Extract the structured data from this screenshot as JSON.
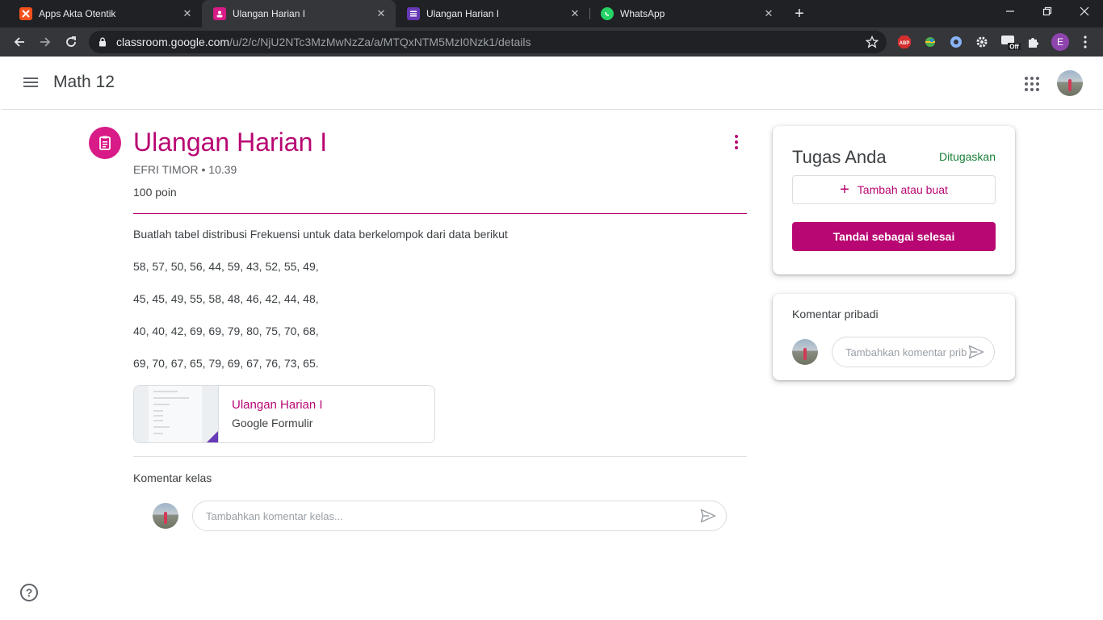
{
  "browser": {
    "tabs": [
      {
        "title": "Apps Akta Otentik",
        "favicon_color": "#f4511e",
        "active": false
      },
      {
        "title": "Ulangan Harian I",
        "favicon_color": "#d81b87",
        "active": true
      },
      {
        "title": "Ulangan Harian I",
        "favicon_color": "#673ab7",
        "active": false
      },
      {
        "title": "WhatsApp",
        "favicon_color": "#25d366",
        "active": false
      }
    ],
    "url_host": "classroom.google.com",
    "url_path": "/u/2/c/NjU2NTc3MzMwNzZa/a/MTQxNTM5MzI0Nzk1/details",
    "extensions": {
      "abp_label": "ABP",
      "off_label": "Off",
      "profile_initial": "E"
    }
  },
  "app": {
    "course_title": "Math 12"
  },
  "assignment": {
    "title": "Ulangan Harian I",
    "meta": "EFRI TIMOR • 10.39",
    "points": "100 poin",
    "description": [
      "Buatlah tabel distribusi Frekuensi untuk data berkelompok dari data berikut",
      "58, 57, 50, 56, 44, 59, 43, 52, 55, 49,",
      "45, 45, 49, 55, 58, 48, 46, 42, 44, 48,",
      "40, 40, 42, 69, 69, 79, 80, 75, 70, 68,",
      "69, 70, 67, 65, 79, 69, 67, 76, 73, 65."
    ],
    "attachment": {
      "name": "Ulangan Harian I",
      "type": "Google Formulir"
    },
    "class_comments_label": "Komentar kelas",
    "class_comment_placeholder": "Tambahkan komentar kelas..."
  },
  "your_work": {
    "title": "Tugas Anda",
    "status": "Ditugaskan",
    "add_label": "Tambah atau buat",
    "done_label": "Tandai sebagai selesai"
  },
  "private_comments": {
    "title": "Komentar pribadi",
    "placeholder": "Tambahkan komentar pribadi..."
  },
  "help_label": "?",
  "colors": {
    "accent": "#b80672",
    "status": "#188038"
  }
}
